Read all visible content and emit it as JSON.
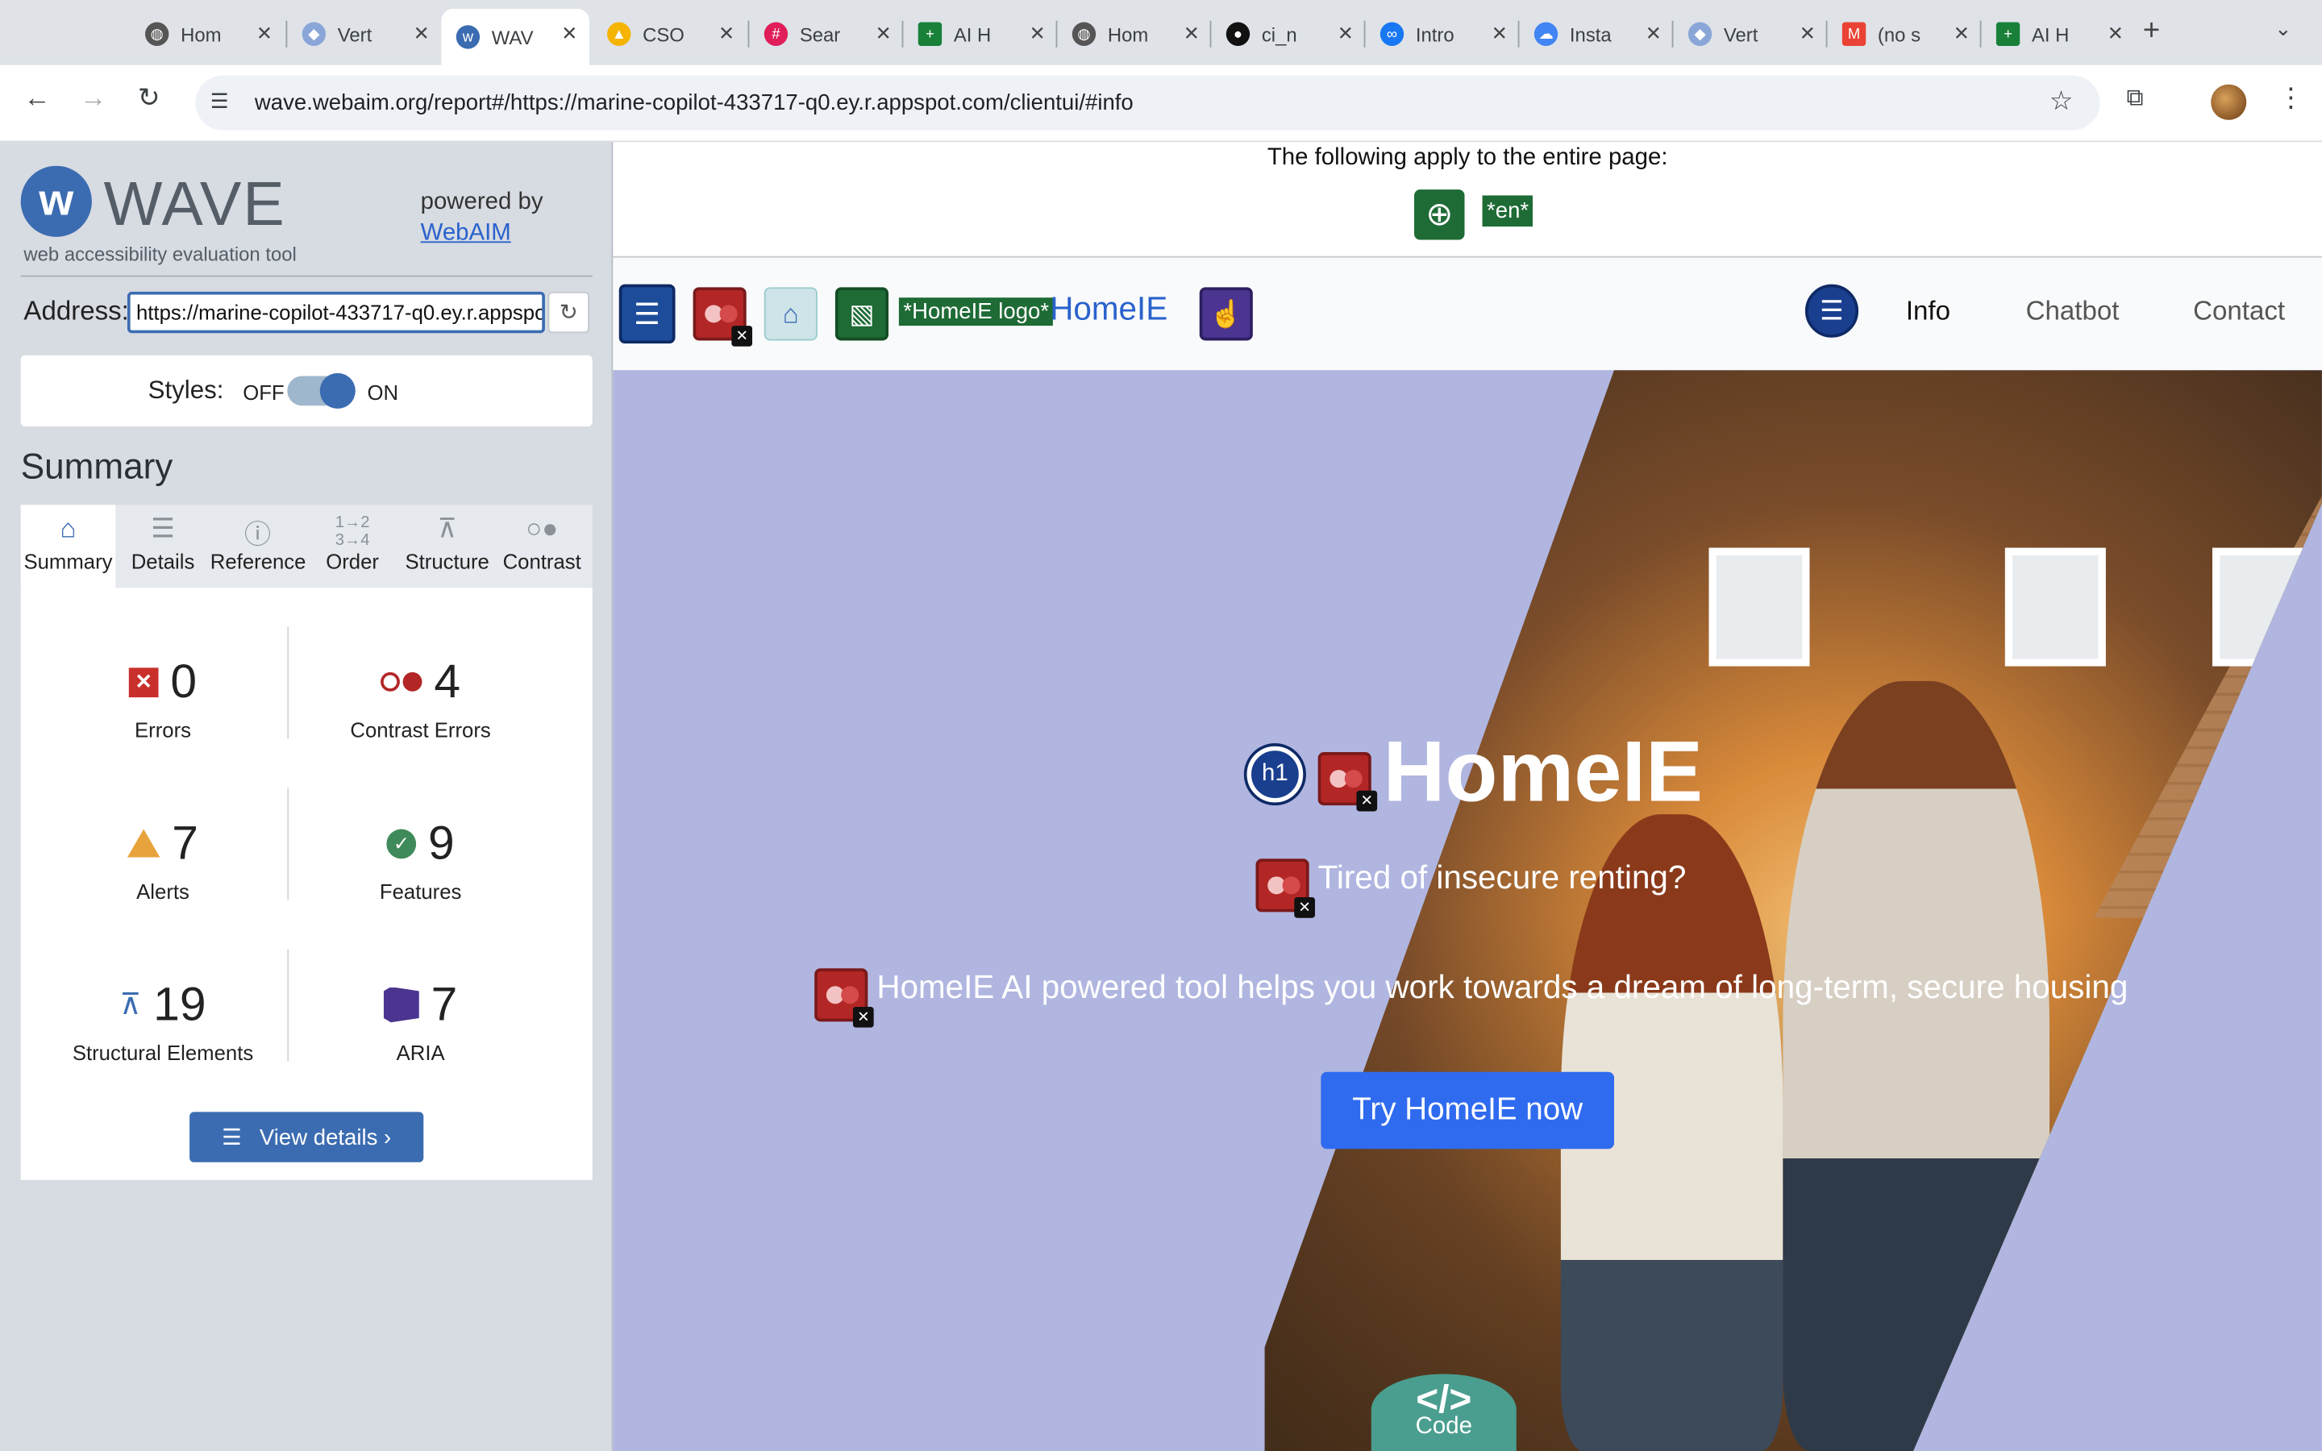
{
  "browser": {
    "tabs": [
      {
        "title": "Hom",
        "icon": "globe-icon"
      },
      {
        "title": "Vert",
        "icon": "vertex-icon"
      },
      {
        "title": "WAV",
        "icon": "wave-icon"
      },
      {
        "title": "CSO",
        "icon": "drive-icon"
      },
      {
        "title": "Sear",
        "icon": "slack-icon"
      },
      {
        "title": "AI H",
        "icon": "sheets-icon"
      },
      {
        "title": "Hom",
        "icon": "globe-icon"
      },
      {
        "title": "ci_n",
        "icon": "github-icon"
      },
      {
        "title": "Intro",
        "icon": "meta-icon"
      },
      {
        "title": "Insta",
        "icon": "cloud-icon"
      },
      {
        "title": "Vert",
        "icon": "vertex-icon"
      },
      {
        "title": "(no s",
        "icon": "gmail-icon"
      },
      {
        "title": "AI H",
        "icon": "sheets-icon"
      }
    ],
    "url": "wave.webaim.org/report#/https://marine-copilot-433717-q0.ey.r.appspot.com/clientui/#info"
  },
  "wave": {
    "logo_word": "WAVE",
    "subtitle": "web accessibility evaluation tool",
    "powered_by": "powered by",
    "webaim_link": "WebAIM",
    "address_label": "Address:",
    "address_value": "https://marine-copilot-433717-q0.ey.r.appspot.com/clientui/#info",
    "styles_label": "Styles:",
    "styles_off": "OFF",
    "styles_on": "ON",
    "summary_heading": "Summary",
    "tabs": [
      "Summary",
      "Details",
      "Reference",
      "Order",
      "Structure",
      "Contrast"
    ],
    "stats": {
      "errors": {
        "value": "0",
        "label": "Errors"
      },
      "contrast": {
        "value": "4",
        "label": "Contrast Errors"
      },
      "alerts": {
        "value": "7",
        "label": "Alerts"
      },
      "features": {
        "value": "9",
        "label": "Features"
      },
      "structural": {
        "value": "19",
        "label": "Structural Elements"
      },
      "aria": {
        "value": "7",
        "label": "ARIA"
      }
    },
    "view_details": "View details ›"
  },
  "page": {
    "apply_text": "The following apply to the entire page:",
    "lang_tag": "*en*",
    "logo_alt_tag": "*HomeIE logo*",
    "brand": "HomeIE",
    "nav": [
      "Info",
      "Chatbot",
      "Contact"
    ],
    "hero_title": "HomeIE",
    "hero_sub": "Tired of insecure renting?",
    "hero_desc": "HomeIE AI powered tool helps you work towards a dream of long-term, secure housing",
    "cta": "Try HomeIE now",
    "code_icon": "</>",
    "code_label": "Code",
    "h1_badge": "h1"
  },
  "colors": {
    "wave_blue": "#3b6cb1",
    "error_red": "#c9302c",
    "feature_green": "#3f8a5a",
    "hero_bg": "#b0b6e0",
    "cta_blue": "#2f6bef"
  }
}
